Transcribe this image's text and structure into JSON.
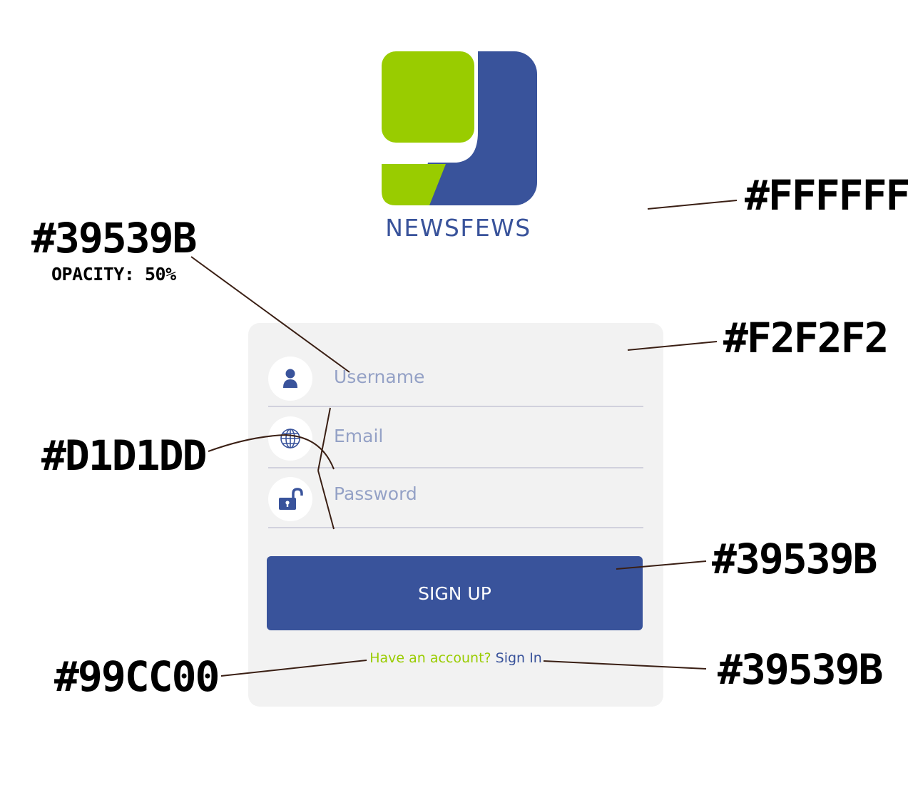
{
  "brand": {
    "name": "NEWSFEWS"
  },
  "form": {
    "username_placeholder": "Username",
    "email_placeholder": "Email",
    "password_placeholder": "Password",
    "signup_label": "SIGN UP",
    "have_account_text": "Have an account?",
    "signin_link": "Sign In"
  },
  "icons": {
    "username": "user-icon",
    "email": "globe-icon",
    "password": "unlock-icon"
  },
  "annotations": {
    "background_color": "#FFFFFF",
    "placeholder_color": "#39539B",
    "placeholder_opacity": "OPACITY: 50%",
    "card_color": "#F2F2F2",
    "divider_color": "#D1D1DD",
    "button_color": "#39539B",
    "have_account_color": "#99CC00",
    "signin_color": "#39539B"
  },
  "colors": {
    "brand_blue": "#39539B",
    "brand_green": "#99CC00",
    "card": "#F2F2F2",
    "divider": "#D1D1DD",
    "background": "#FFFFFF"
  }
}
